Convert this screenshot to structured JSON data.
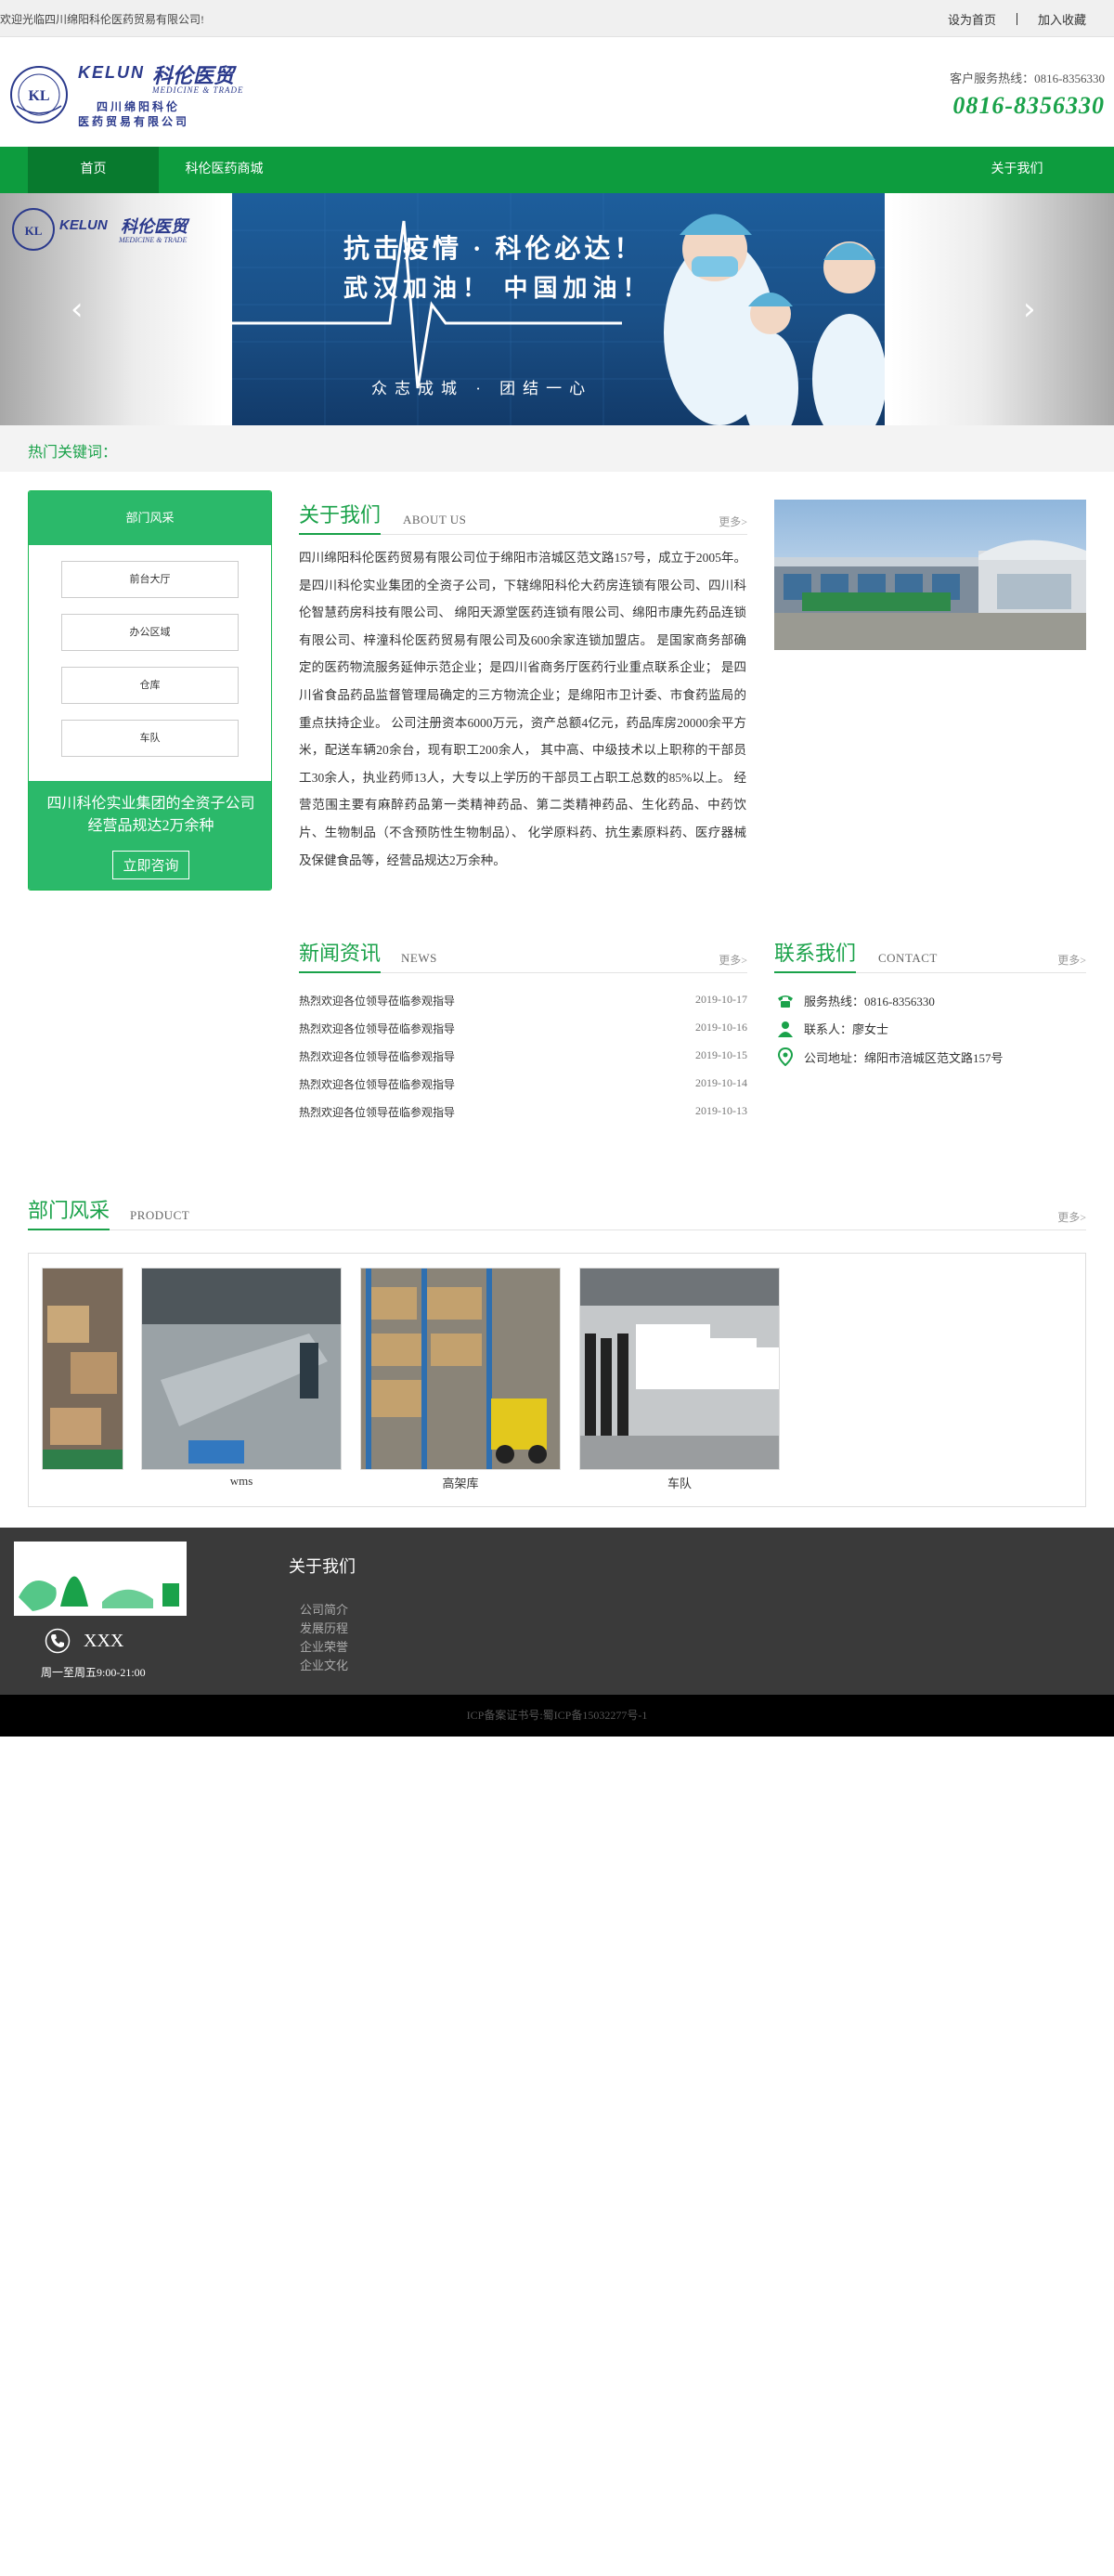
{
  "topbar": {
    "welcome": "欢迎光临四川绵阳科伦医药贸易有限公司!",
    "set_home": "设为首页",
    "add_fav": "加入收藏"
  },
  "header": {
    "logo_en": "KELUN",
    "logo_cn": "科伦医贸",
    "logo_sub_en": "MEDICINE & TRADE",
    "logo_line1": "四 川 绵 阳 科 伦",
    "logo_line2": "医 药 贸 易 有 限 公 司",
    "hotline_label": "客户服务热线：0816-8356330",
    "hotline_number": "0816-8356330"
  },
  "nav": {
    "items": [
      {
        "label": "首页",
        "active": true
      },
      {
        "label": "科伦医药商城",
        "active": false
      },
      {
        "label": "关于我们",
        "active": false
      }
    ]
  },
  "banner": {
    "slogan1": "抗击疫情 · 科伦必达！",
    "slogan2": "武汉加油！ 中国加油！",
    "slogan3": "众志成城 · 团结一心",
    "prev_icon": "chevron-left-icon",
    "next_icon": "chevron-right-icon"
  },
  "hot_keywords": {
    "label": "热门关键词："
  },
  "sidebar": {
    "title": "部门风采",
    "buttons": [
      "前台大厅",
      "办公区域",
      "仓库",
      "车队"
    ],
    "promo_line1": "四川科伦实业集团的全资子公司",
    "promo_line2": "经营品规达2万余种",
    "consult": "立即咨询"
  },
  "about": {
    "title": "关于我们",
    "en": "ABOUT US",
    "more": "更多>",
    "text": "四川绵阳科伦医药贸易有限公司位于绵阳市涪城区范文路157号，成立于2005年。 是四川科伦实业集团的全资子公司，下辖绵阳科伦大药房连锁有限公司、四川科伦智慧药房科技有限公司、 绵阳天源堂医药连锁有限公司、绵阳市康先药品连锁有限公司、梓潼科伦医药贸易有限公司及600余家连锁加盟店。 是国家商务部确定的医药物流服务延伸示范企业；是四川省商务厅医药行业重点联系企业； 是四川省食品药品监督管理局确定的三方物流企业；是绵阳市卫计委、市食药监局的重点扶持企业。 公司注册资本6000万元，资产总额4亿元，药品库房20000余平方米，配送车辆20余台，现有职工200余人， 其中高、中级技术以上职称的干部员工30余人，执业药师13人，大专以上学历的干部员工占职工总数的85%以上。 经营范围主要有麻醉药品第一类精神药品、第二类精神药品、生化药品、中药饮片、生物制品（不含预防性生物制品）、 化学原料药、抗生素原料药、医疗器械及保健食品等，经营品规达2万余种。"
  },
  "news": {
    "title": "新闻资讯",
    "en": "NEWS",
    "more": "更多>",
    "items": [
      {
        "title": "热烈欢迎各位领导莅临参观指导",
        "date": "2019-10-17"
      },
      {
        "title": "热烈欢迎各位领导莅临参观指导",
        "date": "2019-10-16"
      },
      {
        "title": "热烈欢迎各位领导莅临参观指导",
        "date": "2019-10-15"
      },
      {
        "title": "热烈欢迎各位领导莅临参观指导",
        "date": "2019-10-14"
      },
      {
        "title": "热烈欢迎各位领导莅临参观指导",
        "date": "2019-10-13"
      }
    ]
  },
  "contact": {
    "title": "联系我们",
    "en": "CONTACT",
    "more": "更多>",
    "phone": "服务热线：0816-8356330",
    "person": "联系人：廖女士",
    "address": "公司地址：绵阳市涪城区范文路157号"
  },
  "product": {
    "title": "部门风采",
    "en": "PRODUCT",
    "more": "更多>",
    "items": [
      {
        "caption": ""
      },
      {
        "caption": "wms"
      },
      {
        "caption": "高架库"
      },
      {
        "caption": "车队"
      }
    ]
  },
  "footer": {
    "phone": "XXX",
    "hours": "周一至周五9:00-21:00",
    "about_title": "关于我们",
    "links": [
      "公司简介",
      "发展历程",
      "企业荣誉",
      "企业文化"
    ],
    "icp": "ICP备案证书号:蜀ICP备15032277号-1"
  },
  "colors": {
    "brand_green": "#0d9c3e",
    "accent_green": "#1aa24a",
    "sidebar_green": "#2bb96a",
    "footer_bg": "#3a3a3a"
  }
}
